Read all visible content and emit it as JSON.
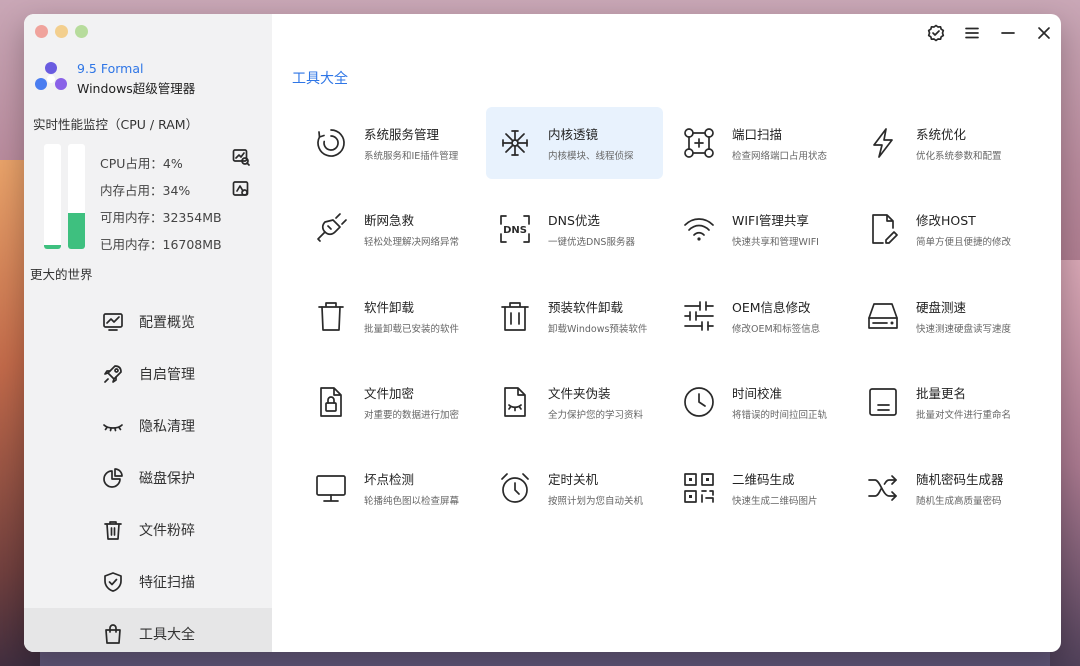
{
  "app": {
    "version": "9.5 Formal",
    "name": "Windows超级管理器"
  },
  "perf": {
    "title": "实时性能监控（CPU / RAM）",
    "cpu_text": "CPU占用：4%",
    "mem_text": "内存占用：34%",
    "free_text": "可用内存：32354MB",
    "used_text": "已用内存：16708MB",
    "cpu_percent": 4,
    "mem_percent": 34,
    "bar_color": "#3ec07f"
  },
  "world_label": "更大的世界",
  "nav": [
    {
      "label": "配置概览",
      "icon": "monitor-chart-icon"
    },
    {
      "label": "自启管理",
      "icon": "rocket-icon"
    },
    {
      "label": "隐私清理",
      "icon": "closed-eye-icon"
    },
    {
      "label": "磁盘保护",
      "icon": "pie-chart-icon"
    },
    {
      "label": "文件粉碎",
      "icon": "trash-icon"
    },
    {
      "label": "特征扫描",
      "icon": "shield-check-icon"
    },
    {
      "label": "工具大全",
      "icon": "shopping-bag-icon",
      "active": true
    }
  ],
  "section_title": "工具大全",
  "tools": [
    {
      "title": "系统服务管理",
      "sub": "系统服务和IE插件管理",
      "icon": "service-circle-icon"
    },
    {
      "title": "内核透镜",
      "sub": "内核模块、线程侦探",
      "icon": "network-node-icon",
      "active": true
    },
    {
      "title": "端口扫描",
      "sub": "检查网络端口占用状态",
      "icon": "port-scan-icon"
    },
    {
      "title": "系统优化",
      "sub": "优化系统参数和配置",
      "icon": "lightning-icon"
    },
    {
      "title": "断网急救",
      "sub": "轻松处理解决网络异常",
      "icon": "plug-icon"
    },
    {
      "title": "DNS优选",
      "sub": "一键优选DNS服务器",
      "icon": "dns-icon"
    },
    {
      "title": "WIFI管理共享",
      "sub": "快速共享和管理WIFI",
      "icon": "wifi-icon"
    },
    {
      "title": "修改HOST",
      "sub": "简单方便且便捷的修改",
      "icon": "file-edit-icon"
    },
    {
      "title": "软件卸载",
      "sub": "批量卸载已安装的软件",
      "icon": "bin-icon"
    },
    {
      "title": "预装软件卸载",
      "sub": "卸载Windows预装软件",
      "icon": "bin-box-icon"
    },
    {
      "title": "OEM信息修改",
      "sub": "修改OEM和标签信息",
      "icon": "sliders-icon"
    },
    {
      "title": "硬盘测速",
      "sub": "快速测速硬盘读写速度",
      "icon": "hard-drive-icon"
    },
    {
      "title": "文件加密",
      "sub": "对重要的数据进行加密",
      "icon": "file-lock-icon"
    },
    {
      "title": "文件夹伪装",
      "sub": "全力保护您的学习资料",
      "icon": "file-hidden-icon"
    },
    {
      "title": "时间校准",
      "sub": "将错误的时间拉回正轨",
      "icon": "clock-icon"
    },
    {
      "title": "批量更名",
      "sub": "批量对文件进行重命名",
      "icon": "rename-icon"
    },
    {
      "title": "坏点检测",
      "sub": "轮播纯色图以检查屏幕",
      "icon": "monitor-icon"
    },
    {
      "title": "定时关机",
      "sub": "按照计划为您自动关机",
      "icon": "alarm-clock-icon"
    },
    {
      "title": "二维码生成",
      "sub": "快速生成二维码图片",
      "icon": "qr-code-icon"
    },
    {
      "title": "随机密码生成器",
      "sub": "随机生成高质量密码",
      "icon": "shuffle-icon"
    }
  ],
  "colors": {
    "accent": "#2f76e6",
    "sidebar_bg": "#f2f2f3",
    "active_tool_bg": "#e8f2fd"
  }
}
